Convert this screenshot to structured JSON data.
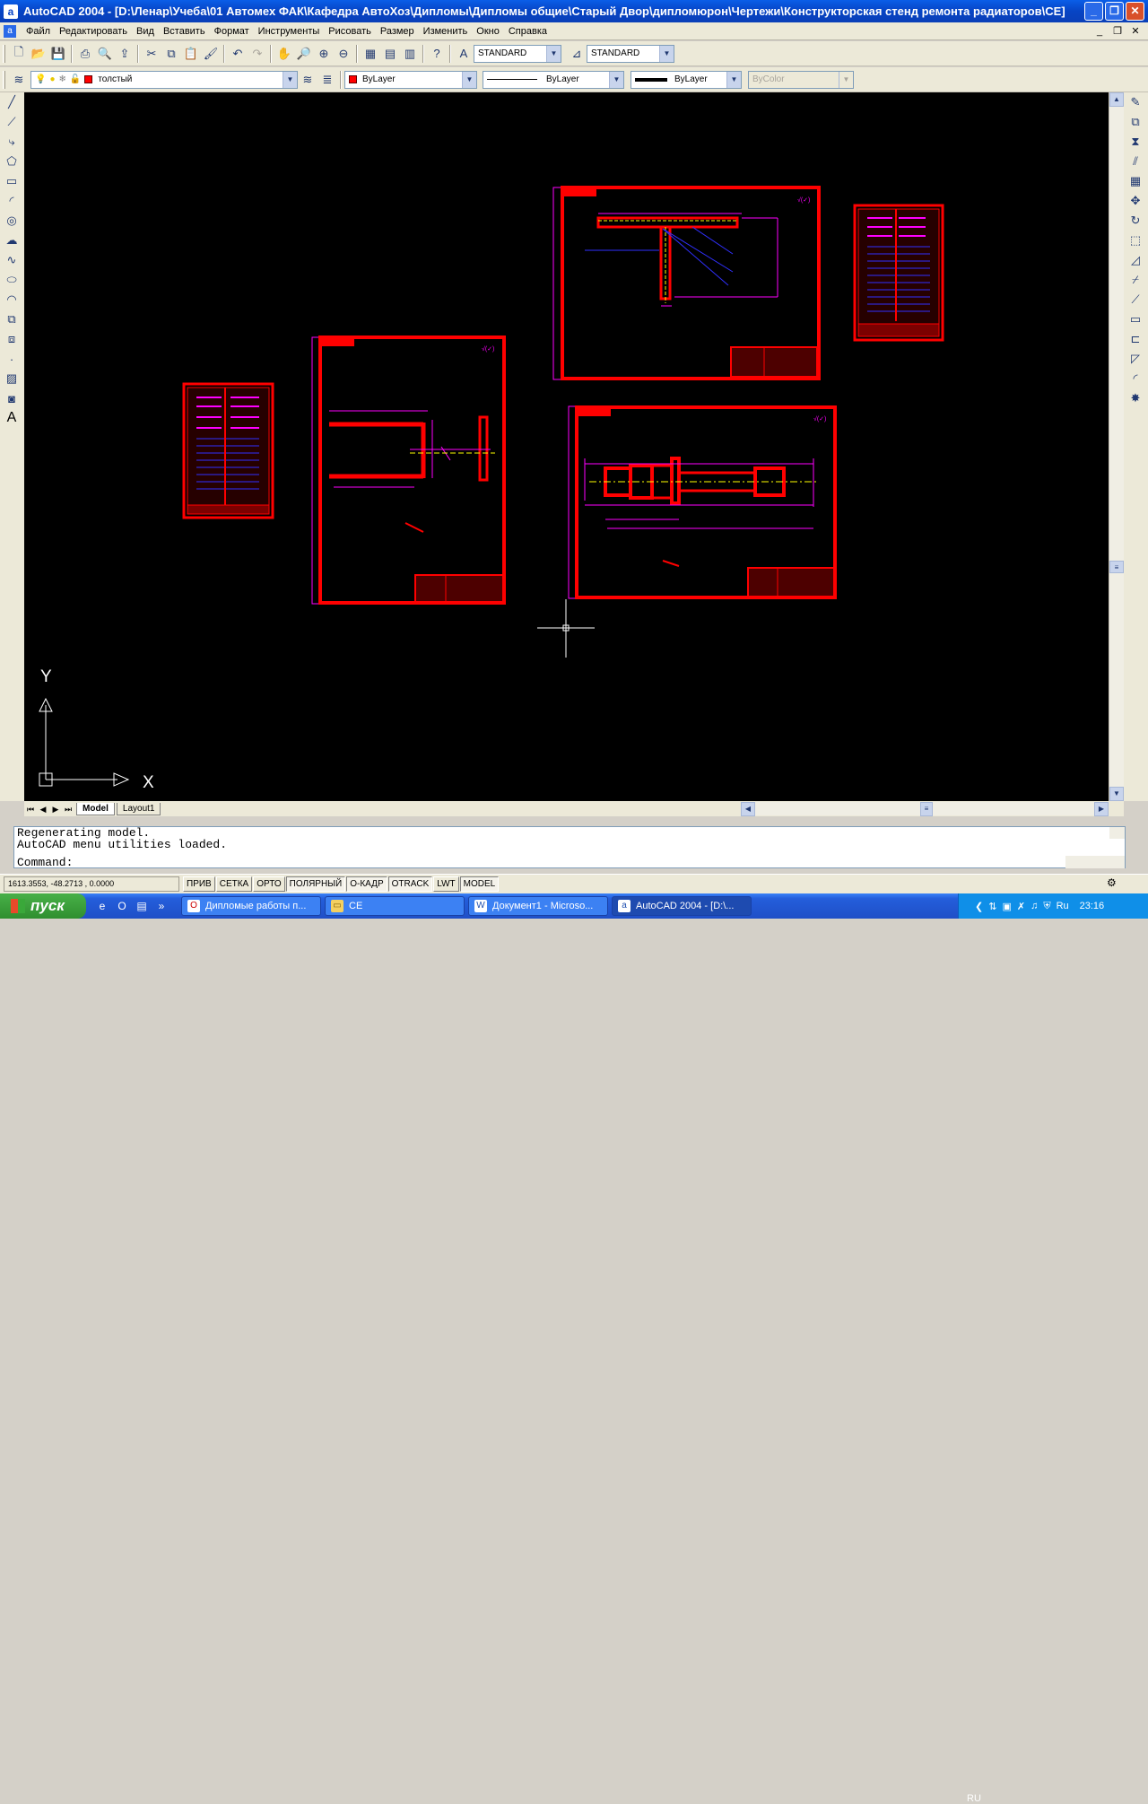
{
  "window": {
    "title": "AutoCAD 2004 - [D:\\Ленар\\Учеба\\01 Автомех ФАК\\Кафедра АвтоХоз\\Дипломы\\Дипломы общие\\Старый Двор\\дипломюрон\\Чертежи\\Конструкторская стенд ремонта радиаторов\\CE]",
    "minimize": "_",
    "maximize": "❐",
    "close": "✕"
  },
  "menu": [
    "Файл",
    "Редактировать",
    "Вид",
    "Вставить",
    "Формат",
    "Инструменты",
    "Рисовать",
    "Размер",
    "Изменить",
    "Окно",
    "Справка"
  ],
  "styles": {
    "text_style": "STANDARD",
    "dim_style": "STANDARD"
  },
  "layers": {
    "current_layer": "толстый",
    "color": "ByLayer",
    "linetype": "ByLayer",
    "lineweight": "ByLayer",
    "plot_style": "ByColor"
  },
  "canvas": {
    "ucs_y": "Y",
    "ucs_x": "X",
    "drawing_color": "#ff0000",
    "dim_color": "#ff00ff"
  },
  "tabs": [
    "Model",
    "Layout1"
  ],
  "command": {
    "line1": "Regenerating model.",
    "line2": "AutoCAD menu utilities loaded.",
    "prompt": "Command:"
  },
  "status": {
    "coords": "1613.3553, -48.2713 , 0.0000",
    "buttons": [
      "ПРИВ",
      "СЕТКА",
      "ОРТО",
      "ПОЛЯРНЫЙ",
      "О-КАДР",
      "OTRACK",
      "LWT",
      "MODEL"
    ]
  },
  "taskbar": {
    "start": "пуск",
    "tasks": [
      "Дипломые работы п...",
      "CE",
      "Документ1 - Microso...",
      "AutoCAD 2004 - [D:\\..."
    ],
    "lang": "RU",
    "tray_lang": "Ru",
    "clock": "23:16"
  }
}
